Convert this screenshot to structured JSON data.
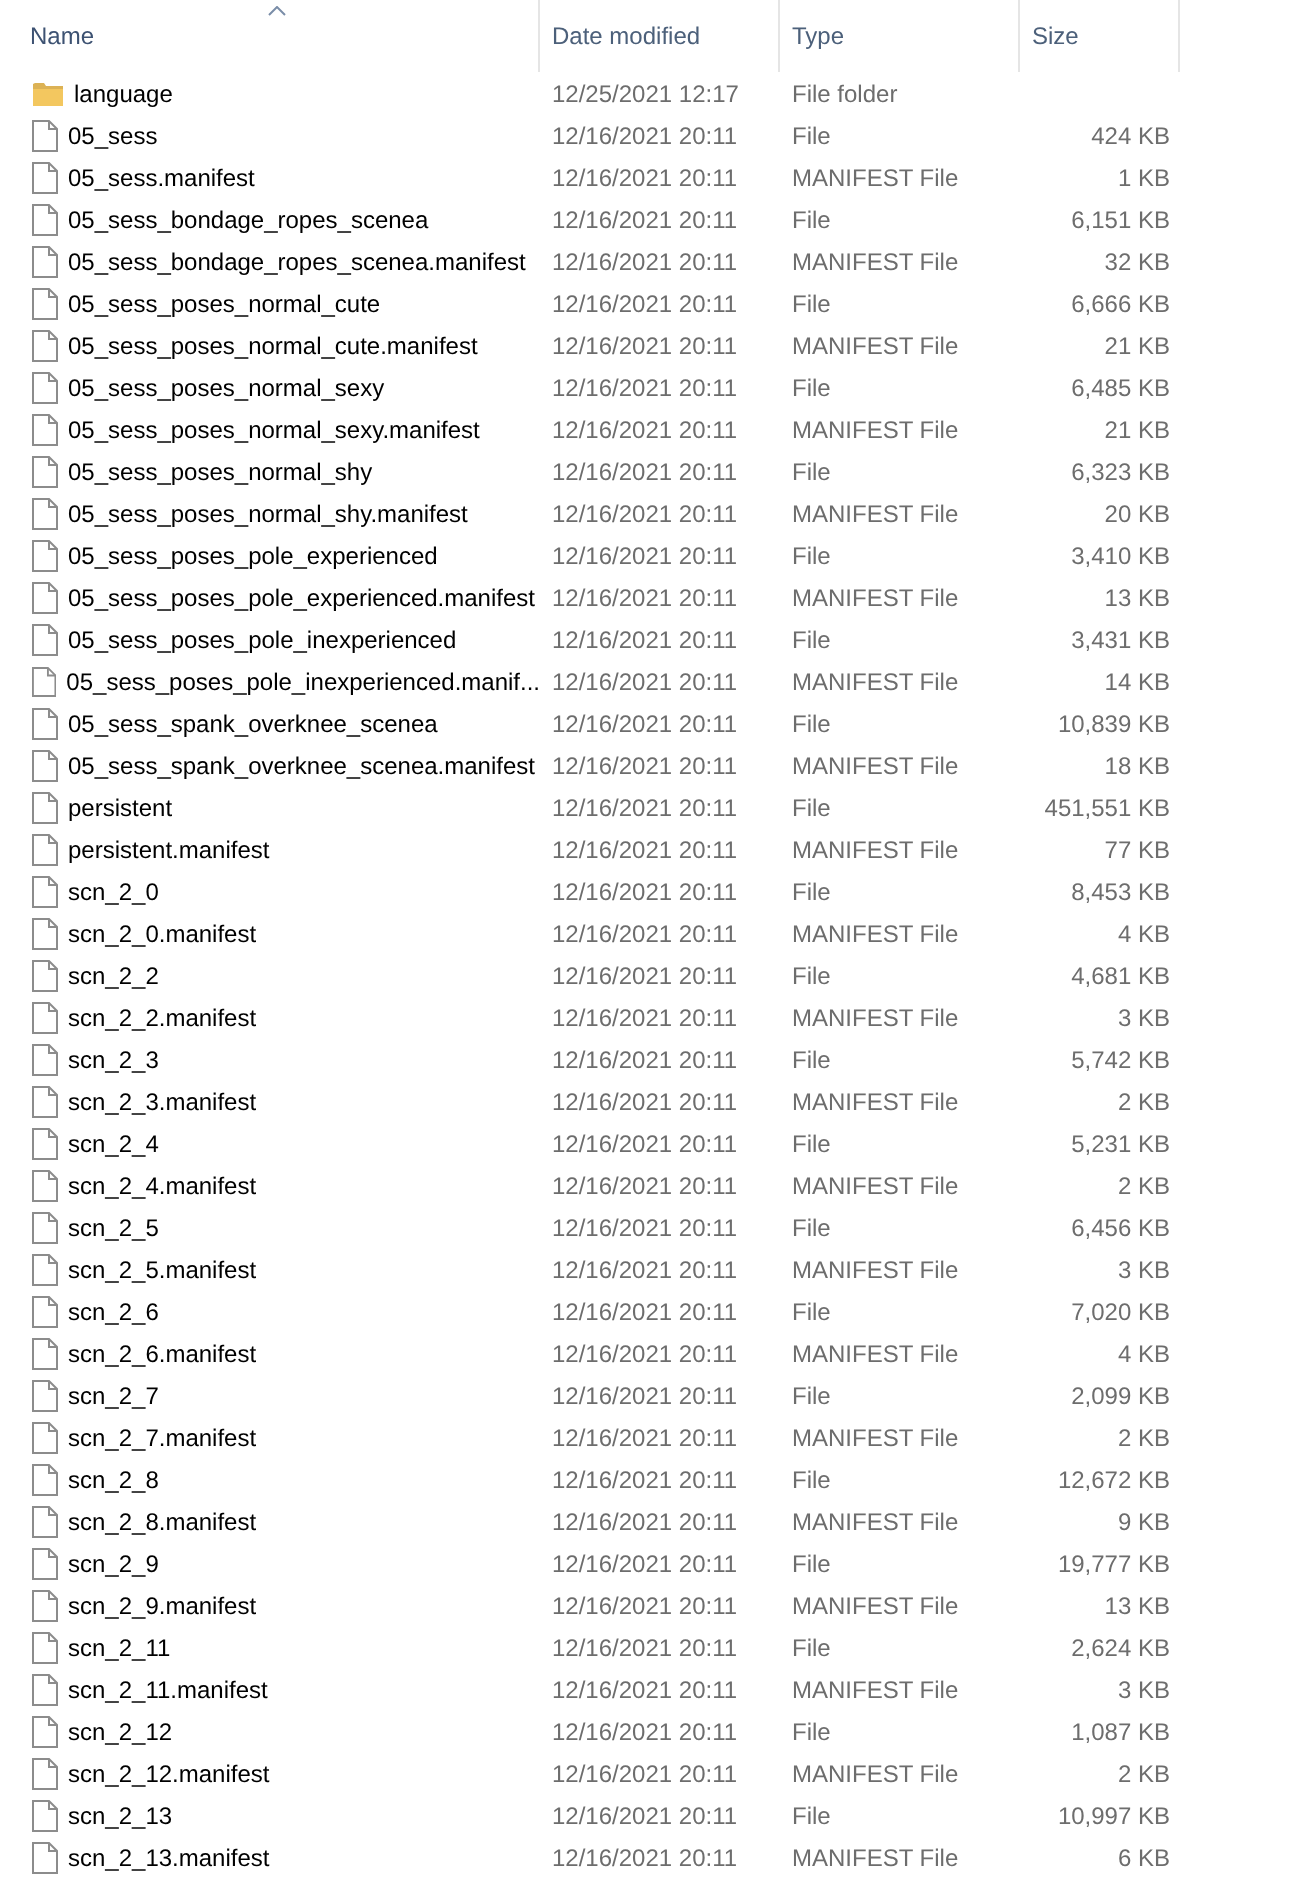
{
  "columns": [
    {
      "label": "Name",
      "sorted": true
    },
    {
      "label": "Date modified",
      "sorted": false
    },
    {
      "label": "Type",
      "sorted": false
    },
    {
      "label": "Size",
      "sorted": false
    }
  ],
  "rows": [
    {
      "kind": "folder",
      "name": "language",
      "date": "12/25/2021 12:17",
      "type": "File folder"
    },
    {
      "kind": "file",
      "name": "05_sess",
      "date": "12/16/2021 20:11",
      "type": "File",
      "size": "424 KB"
    },
    {
      "kind": "file",
      "name": "05_sess.manifest",
      "date": "12/16/2021 20:11",
      "type": "MANIFEST File",
      "size": "1 KB"
    },
    {
      "kind": "file",
      "name": "05_sess_bondage_ropes_scenea",
      "date": "12/16/2021 20:11",
      "type": "File",
      "size": "6,151 KB"
    },
    {
      "kind": "file",
      "name": "05_sess_bondage_ropes_scenea.manifest",
      "date": "12/16/2021 20:11",
      "type": "MANIFEST File",
      "size": "32 KB"
    },
    {
      "kind": "file",
      "name": "05_sess_poses_normal_cute",
      "date": "12/16/2021 20:11",
      "type": "File",
      "size": "6,666 KB"
    },
    {
      "kind": "file",
      "name": "05_sess_poses_normal_cute.manifest",
      "date": "12/16/2021 20:11",
      "type": "MANIFEST File",
      "size": "21 KB"
    },
    {
      "kind": "file",
      "name": "05_sess_poses_normal_sexy",
      "date": "12/16/2021 20:11",
      "type": "File",
      "size": "6,485 KB"
    },
    {
      "kind": "file",
      "name": "05_sess_poses_normal_sexy.manifest",
      "date": "12/16/2021 20:11",
      "type": "MANIFEST File",
      "size": "21 KB"
    },
    {
      "kind": "file",
      "name": "05_sess_poses_normal_shy",
      "date": "12/16/2021 20:11",
      "type": "File",
      "size": "6,323 KB"
    },
    {
      "kind": "file",
      "name": "05_sess_poses_normal_shy.manifest",
      "date": "12/16/2021 20:11",
      "type": "MANIFEST File",
      "size": "20 KB"
    },
    {
      "kind": "file",
      "name": "05_sess_poses_pole_experienced",
      "date": "12/16/2021 20:11",
      "type": "File",
      "size": "3,410 KB"
    },
    {
      "kind": "file",
      "name": "05_sess_poses_pole_experienced.manifest",
      "date": "12/16/2021 20:11",
      "type": "MANIFEST File",
      "size": "13 KB"
    },
    {
      "kind": "file",
      "name": "05_sess_poses_pole_inexperienced",
      "date": "12/16/2021 20:11",
      "type": "File",
      "size": "3,431 KB"
    },
    {
      "kind": "file",
      "name": "05_sess_poses_pole_inexperienced.manif...",
      "date": "12/16/2021 20:11",
      "type": "MANIFEST File",
      "size": "14 KB"
    },
    {
      "kind": "file",
      "name": "05_sess_spank_overknee_scenea",
      "date": "12/16/2021 20:11",
      "type": "File",
      "size": "10,839 KB"
    },
    {
      "kind": "file",
      "name": "05_sess_spank_overknee_scenea.manifest",
      "date": "12/16/2021 20:11",
      "type": "MANIFEST File",
      "size": "18 KB"
    },
    {
      "kind": "file",
      "name": "persistent",
      "date": "12/16/2021 20:11",
      "type": "File",
      "size": "451,551 KB"
    },
    {
      "kind": "file",
      "name": "persistent.manifest",
      "date": "12/16/2021 20:11",
      "type": "MANIFEST File",
      "size": "77 KB"
    },
    {
      "kind": "file",
      "name": "scn_2_0",
      "date": "12/16/2021 20:11",
      "type": "File",
      "size": "8,453 KB"
    },
    {
      "kind": "file",
      "name": "scn_2_0.manifest",
      "date": "12/16/2021 20:11",
      "type": "MANIFEST File",
      "size": "4 KB"
    },
    {
      "kind": "file",
      "name": "scn_2_2",
      "date": "12/16/2021 20:11",
      "type": "File",
      "size": "4,681 KB"
    },
    {
      "kind": "file",
      "name": "scn_2_2.manifest",
      "date": "12/16/2021 20:11",
      "type": "MANIFEST File",
      "size": "3 KB"
    },
    {
      "kind": "file",
      "name": "scn_2_3",
      "date": "12/16/2021 20:11",
      "type": "File",
      "size": "5,742 KB"
    },
    {
      "kind": "file",
      "name": "scn_2_3.manifest",
      "date": "12/16/2021 20:11",
      "type": "MANIFEST File",
      "size": "2 KB"
    },
    {
      "kind": "file",
      "name": "scn_2_4",
      "date": "12/16/2021 20:11",
      "type": "File",
      "size": "5,231 KB"
    },
    {
      "kind": "file",
      "name": "scn_2_4.manifest",
      "date": "12/16/2021 20:11",
      "type": "MANIFEST File",
      "size": "2 KB"
    },
    {
      "kind": "file",
      "name": "scn_2_5",
      "date": "12/16/2021 20:11",
      "type": "File",
      "size": "6,456 KB"
    },
    {
      "kind": "file",
      "name": "scn_2_5.manifest",
      "date": "12/16/2021 20:11",
      "type": "MANIFEST File",
      "size": "3 KB"
    },
    {
      "kind": "file",
      "name": "scn_2_6",
      "date": "12/16/2021 20:11",
      "type": "File",
      "size": "7,020 KB"
    },
    {
      "kind": "file",
      "name": "scn_2_6.manifest",
      "date": "12/16/2021 20:11",
      "type": "MANIFEST File",
      "size": "4 KB"
    },
    {
      "kind": "file",
      "name": "scn_2_7",
      "date": "12/16/2021 20:11",
      "type": "File",
      "size": "2,099 KB"
    },
    {
      "kind": "file",
      "name": "scn_2_7.manifest",
      "date": "12/16/2021 20:11",
      "type": "MANIFEST File",
      "size": "2 KB"
    },
    {
      "kind": "file",
      "name": "scn_2_8",
      "date": "12/16/2021 20:11",
      "type": "File",
      "size": "12,672 KB"
    },
    {
      "kind": "file",
      "name": "scn_2_8.manifest",
      "date": "12/16/2021 20:11",
      "type": "MANIFEST File",
      "size": "9 KB"
    },
    {
      "kind": "file",
      "name": "scn_2_9",
      "date": "12/16/2021 20:11",
      "type": "File",
      "size": "19,777 KB"
    },
    {
      "kind": "file",
      "name": "scn_2_9.manifest",
      "date": "12/16/2021 20:11",
      "type": "MANIFEST File",
      "size": "13 KB"
    },
    {
      "kind": "file",
      "name": "scn_2_11",
      "date": "12/16/2021 20:11",
      "type": "File",
      "size": "2,624 KB"
    },
    {
      "kind": "file",
      "name": "scn_2_11.manifest",
      "date": "12/16/2021 20:11",
      "type": "MANIFEST File",
      "size": "3 KB"
    },
    {
      "kind": "file",
      "name": "scn_2_12",
      "date": "12/16/2021 20:11",
      "type": "File",
      "size": "1,087 KB"
    },
    {
      "kind": "file",
      "name": "scn_2_12.manifest",
      "date": "12/16/2021 20:11",
      "type": "MANIFEST File",
      "size": "2 KB"
    },
    {
      "kind": "file",
      "name": "scn_2_13",
      "date": "12/16/2021 20:11",
      "type": "File",
      "size": "10,997 KB"
    },
    {
      "kind": "file",
      "name": "scn_2_13.manifest",
      "date": "12/16/2021 20:11",
      "type": "MANIFEST File",
      "size": "6 KB"
    }
  ]
}
